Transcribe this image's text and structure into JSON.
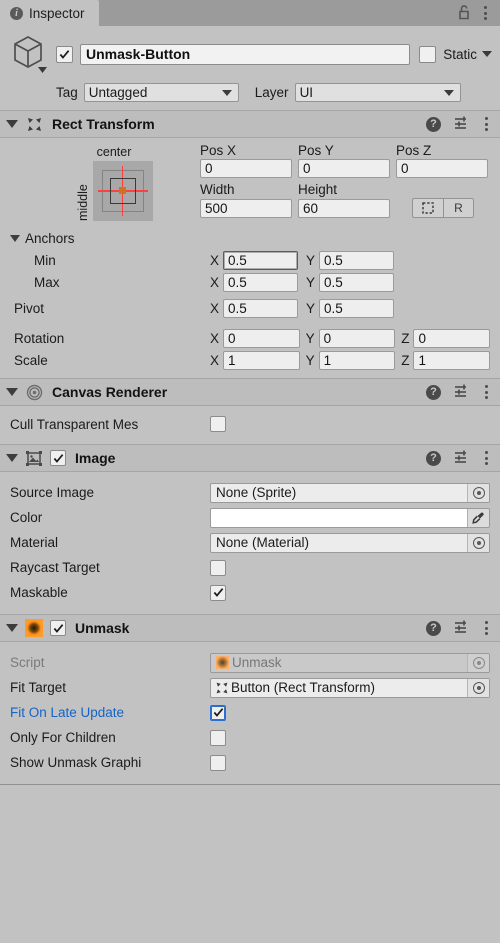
{
  "window": {
    "tab_label": "Inspector",
    "tab_icon": "info-icon",
    "lock_icon": "unlocked-padlock-icon",
    "menu_icon": "kebab-menu-icon"
  },
  "gameobject": {
    "icon": "cube-icon",
    "enabled": true,
    "name": "Unmask-Button",
    "static_label": "Static",
    "static_checked": false,
    "tag_label": "Tag",
    "tag_value": "Untagged",
    "layer_label": "Layer",
    "layer_value": "UI"
  },
  "rect_transform": {
    "title": "Rect Transform",
    "icon": "rect-transform-icon",
    "anchor_preset": {
      "horizontal": "center",
      "vertical": "middle"
    },
    "pos_labels": [
      "Pos X",
      "Pos Y",
      "Pos Z"
    ],
    "pos_values": [
      "0",
      "0",
      "0"
    ],
    "size_labels": [
      "Width",
      "Height"
    ],
    "size_values": [
      "500",
      "60"
    ],
    "blueprint_button": "blueprint-mode-icon",
    "raw_button": "R",
    "anchors_label": "Anchors",
    "min_label": "Min",
    "min_x": "0.5",
    "min_y": "0.5",
    "max_label": "Max",
    "max_x": "0.5",
    "max_y": "0.5",
    "pivot_label": "Pivot",
    "pivot_x": "0.5",
    "pivot_y": "0.5",
    "rotation_label": "Rotation",
    "rotation": [
      "0",
      "0",
      "0"
    ],
    "scale_label": "Scale",
    "scale": [
      "1",
      "1",
      "1"
    ],
    "axis_x": "X",
    "axis_y": "Y",
    "axis_z": "Z"
  },
  "canvas_renderer": {
    "title": "Canvas Renderer",
    "icon": "bullseye-icon",
    "cull_label": "Cull Transparent Mes",
    "cull_checked": false
  },
  "image": {
    "title": "Image",
    "icon": "image-icon",
    "enabled": true,
    "source_image_label": "Source Image",
    "source_image_value": "None (Sprite)",
    "color_label": "Color",
    "color_value": "#FFFFFF",
    "eyedropper_icon": "eyedropper-icon",
    "material_label": "Material",
    "material_value": "None (Material)",
    "raycast_label": "Raycast Target",
    "raycast_checked": false,
    "maskable_label": "Maskable",
    "maskable_checked": true
  },
  "unmask": {
    "title": "Unmask",
    "icon": "unmask-script-icon",
    "enabled": true,
    "script_label": "Script",
    "script_value": "Unmask",
    "fit_target_label": "Fit Target",
    "fit_target_value": "Button (Rect Transform)",
    "fit_on_late_update_label": "Fit On Late Update",
    "fit_on_late_update_checked": true,
    "only_for_children_label": "Only For Children",
    "only_for_children_checked": false,
    "show_unmask_graphic_label": "Show Unmask Graphi",
    "show_unmask_graphic_checked": false
  },
  "colors": {
    "panel_bg": "#c2c2c2",
    "tabbar_bg": "#9b9b9b",
    "header_bg": "#bdbdbd",
    "override_blue": "#1464c8",
    "accent_orange": "#ff8c1a"
  }
}
